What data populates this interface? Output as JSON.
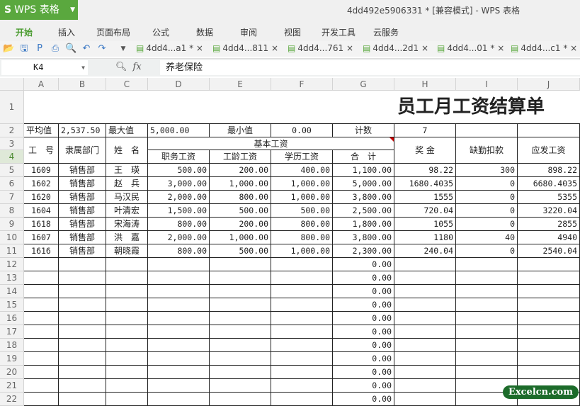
{
  "app": {
    "logo": "WPS 表格",
    "window_title": "4dd492e5906331 * [兼容模式] - WPS 表格"
  },
  "menu": [
    "开始",
    "插入",
    "页面布局",
    "公式",
    "数据",
    "审阅",
    "视图",
    "开发工具",
    "云服务"
  ],
  "toolbar_icons": [
    "open-icon",
    "save-icon",
    "pdf-icon",
    "print-icon",
    "preview-icon",
    "undo-icon",
    "redo-icon"
  ],
  "doc_tabs": [
    "4dd4...a1 * ×",
    "4dd4...811 ×",
    "4dd4...761 ×",
    "4dd4...2d1 ×",
    "4dd4...01 * ×",
    "4dd4...c1 * ×"
  ],
  "formula_bar": {
    "cell_ref": "K4",
    "fx": "fx",
    "content": "养老保险"
  },
  "columns": [
    "A",
    "B",
    "C",
    "D",
    "E",
    "F",
    "G",
    "H",
    "I",
    "J"
  ],
  "rows": [
    "1",
    "2",
    "3",
    "4",
    "5",
    "6",
    "7",
    "8",
    "9",
    "10",
    "11",
    "12",
    "13",
    "14",
    "15",
    "16",
    "17",
    "18",
    "19",
    "20",
    "21",
    "22"
  ],
  "sheet": {
    "title": "员工月工资结算单",
    "stats": {
      "avg_label": "平均值",
      "avg": "2,537.50",
      "max_label": "最大值",
      "max": "5,000.00",
      "min_label": "最小值",
      "min": "0.00",
      "count_label": "计数",
      "count": "7"
    },
    "headers": {
      "id": "工　号",
      "dept": "隶属部门",
      "name": "姓　名",
      "basic": "基本工资",
      "duty": "职务工资",
      "seniority": "工龄工资",
      "edu": "学历工资",
      "total": "合　计",
      "bonus": "奖 金",
      "absence": "缺勤扣款",
      "payable": "应发工资"
    },
    "data": [
      [
        "1609",
        "销售部",
        "王　瑛",
        "500.00",
        "200.00",
        "400.00",
        "1,100.00",
        "98.22",
        "300",
        "898.22"
      ],
      [
        "1602",
        "销售部",
        "赵　兵",
        "3,000.00",
        "1,000.00",
        "1,000.00",
        "5,000.00",
        "1680.4035",
        "0",
        "6680.4035"
      ],
      [
        "1620",
        "销售部",
        "马汉民",
        "2,000.00",
        "800.00",
        "1,000.00",
        "3,800.00",
        "1555",
        "0",
        "5355"
      ],
      [
        "1604",
        "销售部",
        "叶清宏",
        "1,500.00",
        "500.00",
        "500.00",
        "2,500.00",
        "720.04",
        "0",
        "3220.04"
      ],
      [
        "1618",
        "销售部",
        "宋海涛",
        "800.00",
        "200.00",
        "800.00",
        "1,800.00",
        "1055",
        "0",
        "2855"
      ],
      [
        "1607",
        "销售部",
        "洪　嘉",
        "2,000.00",
        "1,000.00",
        "800.00",
        "3,800.00",
        "1180",
        "40",
        "4940"
      ],
      [
        "1616",
        "销售部",
        "朝晓霞",
        "800.00",
        "500.00",
        "1,000.00",
        "2,300.00",
        "240.04",
        "0",
        "2540.04"
      ]
    ],
    "empty_total": "0.00"
  },
  "watermark": "Excelcn.com"
}
